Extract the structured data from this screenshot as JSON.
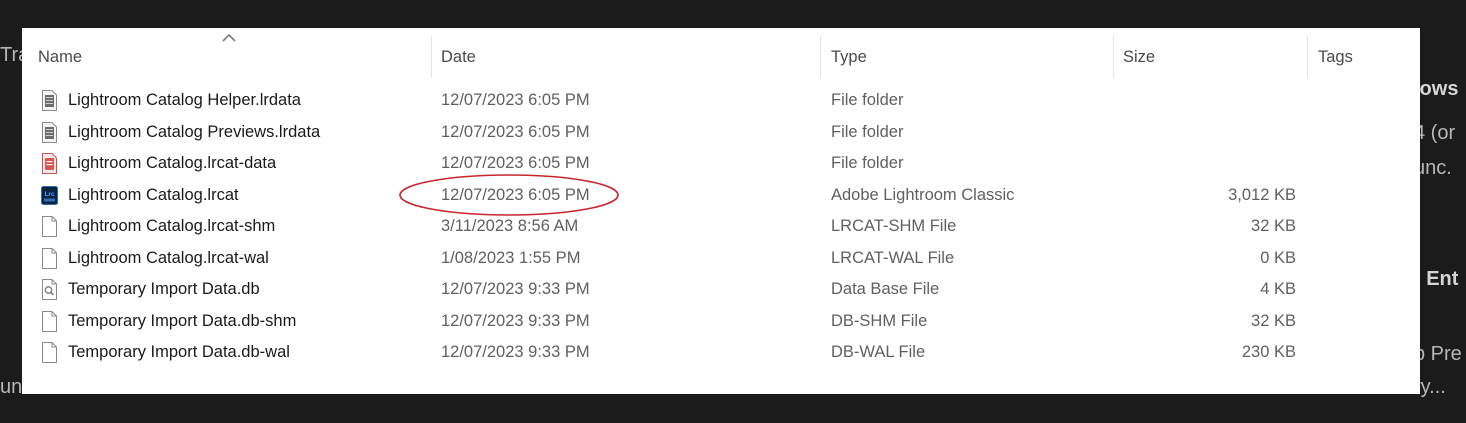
{
  "background": {
    "left_fragments": [
      "Tra",
      "unt"
    ],
    "right_fragments": [
      "lows",
      "4 (or",
      "unc.",
      ": Ent",
      "b Pre",
      "ry..."
    ]
  },
  "explorer": {
    "columns": {
      "name": "Name",
      "date": "Date",
      "type": "Type",
      "size": "Size",
      "tags": "Tags"
    },
    "sort": {
      "column": "Name",
      "direction": "ascending",
      "icon": "chevron-up-icon"
    },
    "files": [
      {
        "name": "Lightroom Catalog Helper.lrdata",
        "date": "12/07/2023 6:05 PM",
        "type": "File folder",
        "size": "",
        "icon": "lrdata-file-icon"
      },
      {
        "name": "Lightroom Catalog Previews.lrdata",
        "date": "12/07/2023 6:05 PM",
        "type": "File folder",
        "size": "",
        "icon": "lrdata-file-icon"
      },
      {
        "name": "Lightroom Catalog.lrcat-data",
        "date": "12/07/2023 6:05 PM",
        "type": "File folder",
        "size": "",
        "icon": "lrcat-data-file-icon"
      },
      {
        "name": "Lightroom Catalog.lrcat",
        "date": "12/07/2023 6:05 PM",
        "type": "Adobe Lightroom Classic",
        "size": "3,012 KB",
        "icon": "lightroom-classic-icon"
      },
      {
        "name": "Lightroom Catalog.lrcat-shm",
        "date": "3/11/2023 8:56 AM",
        "type": "LRCAT-SHM File",
        "size": "32 KB",
        "icon": "blank-file-icon"
      },
      {
        "name": "Lightroom Catalog.lrcat-wal",
        "date": "1/08/2023 1:55 PM",
        "type": "LRCAT-WAL File",
        "size": "0 KB",
        "icon": "blank-file-icon"
      },
      {
        "name": "Temporary Import Data.db",
        "date": "12/07/2023 9:33 PM",
        "type": "Data Base File",
        "size": "4 KB",
        "icon": "database-file-icon"
      },
      {
        "name": "Temporary Import Data.db-shm",
        "date": "12/07/2023 9:33 PM",
        "type": "DB-SHM File",
        "size": "32 KB",
        "icon": "blank-file-icon"
      },
      {
        "name": "Temporary Import Data.db-wal",
        "date": "12/07/2023 9:33 PM",
        "type": "DB-WAL File",
        "size": "230 KB",
        "icon": "blank-file-icon"
      }
    ]
  },
  "annotation": {
    "color": "#c8262b",
    "shape": "ellipse",
    "target": "Lightroom Catalog.lrcat date"
  }
}
